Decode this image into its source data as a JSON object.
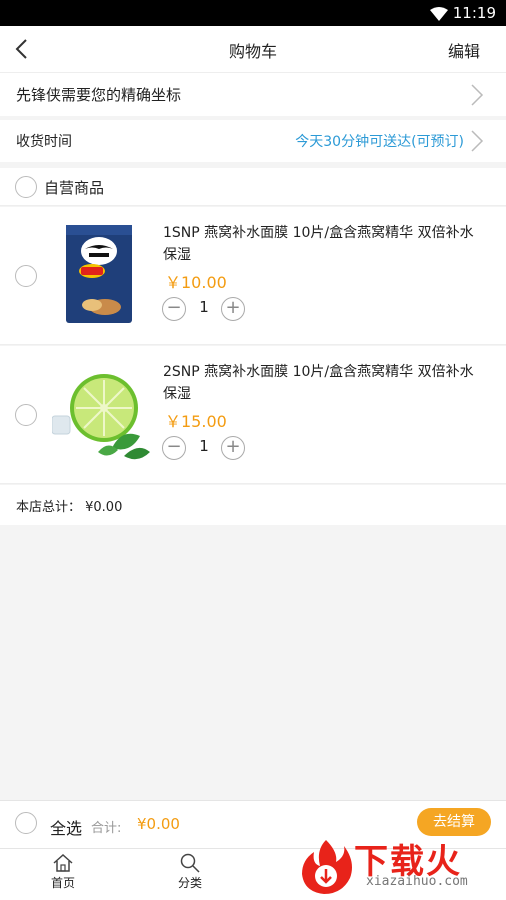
{
  "status_bar": {
    "time": "11:19"
  },
  "header": {
    "title": "购物车",
    "edit_label": "编辑"
  },
  "location": {
    "text": "先锋侠需要您的精确坐标"
  },
  "delivery": {
    "label": "收货时间",
    "value": "今天30分钟可送达(可预订)"
  },
  "shop": {
    "name": "自营商品"
  },
  "items": [
    {
      "name": "1SNP 燕窝补水面膜 10片/盒含燕窝精华 双倍补水保湿",
      "price": "￥10.00",
      "quantity": "1",
      "image": "chips-bag"
    },
    {
      "name": "2SNP 燕窝补水面膜 10片/盒含燕窝精华 双倍补水保湿",
      "price": "￥15.00",
      "quantity": "1",
      "image": "lime-mint"
    }
  ],
  "subtotal": {
    "label": "本店总计：  ¥0.00"
  },
  "footer": {
    "select_all": "全选",
    "total_label": "合计:",
    "total_value": "¥0.00",
    "checkout": "去结算"
  },
  "tabs": [
    {
      "label": "首页",
      "icon": "home-icon"
    },
    {
      "label": "分类",
      "icon": "search-icon"
    }
  ],
  "watermark": {
    "text": "下载火",
    "sub": "xiazaihuo.com"
  },
  "colors": {
    "accent": "#f39c12",
    "link": "#2c9ad6",
    "checkout_bg": "#f5a623"
  }
}
